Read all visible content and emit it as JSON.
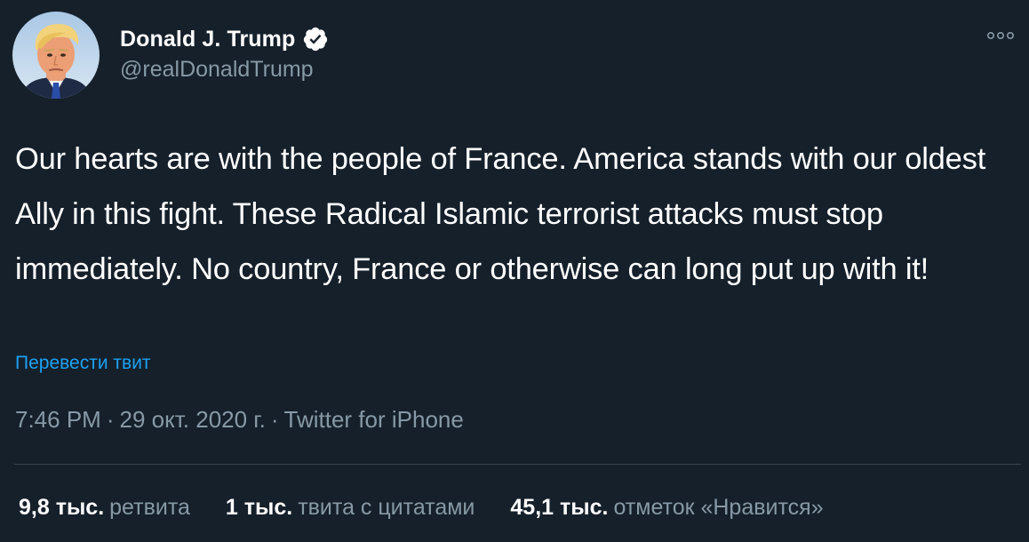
{
  "author": {
    "display_name": "Donald J. Trump",
    "handle": "@realDonaldTrump",
    "verified": true
  },
  "icons": {
    "avatar": "profile-photo",
    "verified": "verified-badge-icon",
    "more": "more-options-icon"
  },
  "tweet": {
    "text": "Our hearts are with the people of France. America stands with our oldest Ally in this fight. These Radical Islamic terrorist attacks must stop immediately. No country, France or otherwise can long put up with it!",
    "translate_label": "Перевести твит"
  },
  "meta": {
    "time": "7:46 PM",
    "date": "29 окт. 2020 г.",
    "source": "Twitter for iPhone",
    "separator": "·"
  },
  "stats": [
    {
      "count": "9,8 тыс.",
      "label": "ретвита"
    },
    {
      "count": "1 тыс.",
      "label": "твита с цитатами"
    },
    {
      "count": "45,1 тыс.",
      "label": "отметок «Нравится»"
    }
  ],
  "colors": {
    "background": "#15202b",
    "primary_text": "#ffffff",
    "secondary_text": "#8899a6",
    "link": "#1da1f2",
    "divider": "#38444d"
  }
}
